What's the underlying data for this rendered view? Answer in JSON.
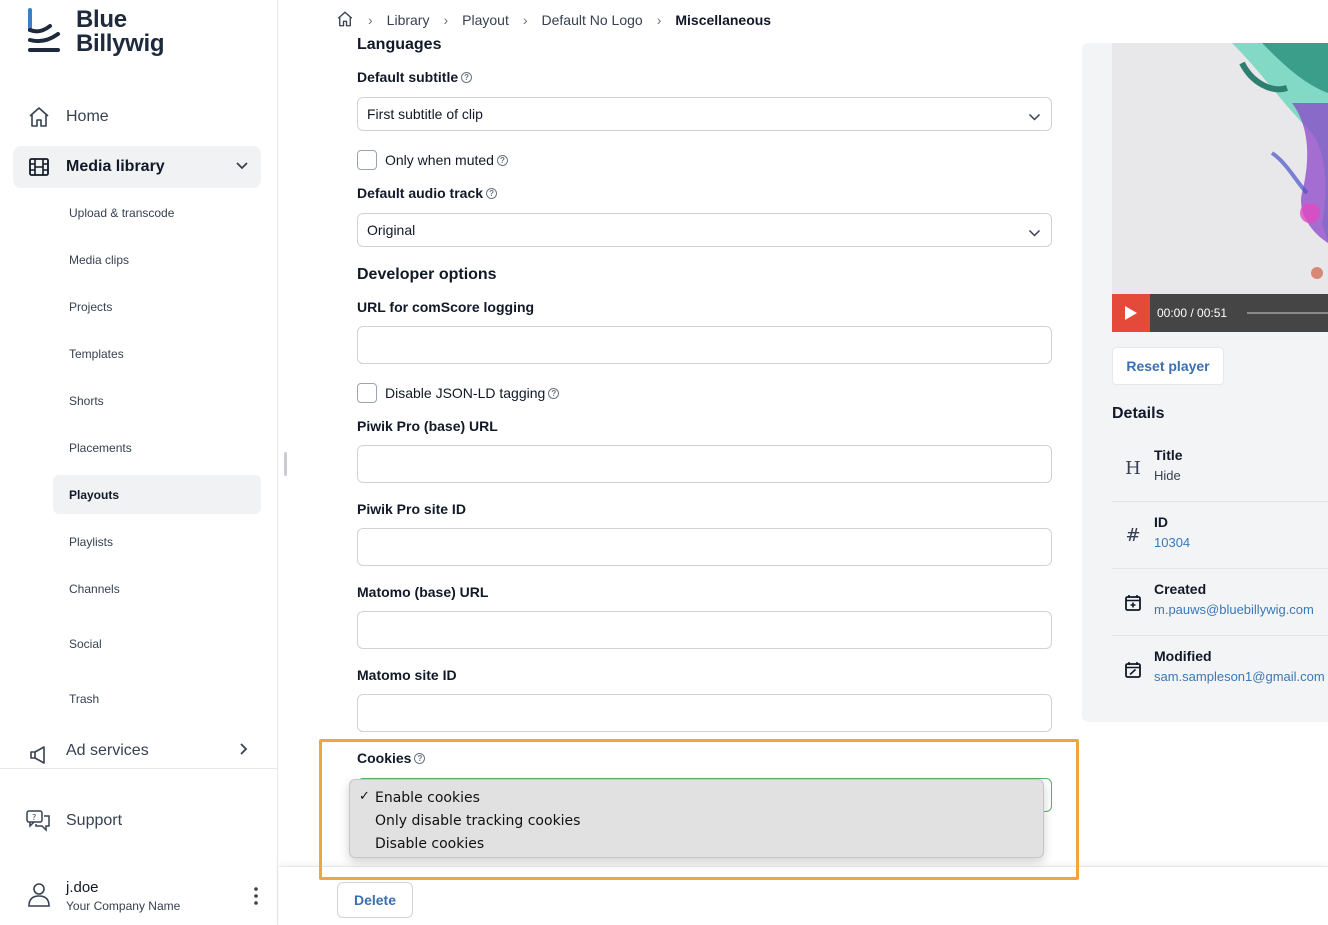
{
  "app": {
    "logo_line1": "Blue",
    "logo_line2": "Billywig"
  },
  "sidebar": {
    "home": "Home",
    "media_library": "Media library",
    "sub_items": [
      "Upload & transcode",
      "Media clips",
      "Projects",
      "Templates",
      "Shorts",
      "Placements",
      "Playouts",
      "Playlists",
      "Channels",
      "Social",
      "Trash"
    ],
    "active_sub": "Playouts",
    "ad_services": "Ad services",
    "support": "Support",
    "user_name": "j.doe",
    "company": "Your Company Name"
  },
  "breadcrumb": {
    "items": [
      "Library",
      "Playout",
      "Default No Logo"
    ],
    "current": "Miscellaneous"
  },
  "form": {
    "languages_title": "Languages",
    "default_subtitle_label": "Default subtitle",
    "default_subtitle_value": "First subtitle of clip",
    "only_when_muted_label": "Only when muted",
    "default_audio_label": "Default audio track",
    "default_audio_value": "Original",
    "developer_title": "Developer options",
    "comscore_label": "URL for comScore logging",
    "disable_jsonld_label": "Disable JSON-LD tagging",
    "piwik_url_label": "Piwik Pro (base) URL",
    "piwik_site_label": "Piwik Pro site ID",
    "matomo_url_label": "Matomo (base) URL",
    "matomo_site_label": "Matomo site ID",
    "cookies_label": "Cookies",
    "cookie_options": [
      "Enable cookies",
      "Only disable tracking cookies",
      "Disable cookies"
    ],
    "cookie_selected": "Enable cookies",
    "tick": "✓"
  },
  "actions": {
    "delete": "Delete"
  },
  "right_panel": {
    "time": "00:00 / 00:51",
    "reset_player": "Reset player",
    "details_title": "Details",
    "details": [
      {
        "label": "Title",
        "value": "Hide",
        "icon": "title-icon",
        "glyph": "H"
      },
      {
        "label": "ID",
        "value": "10304",
        "icon": "hash-icon",
        "glyph": "#"
      },
      {
        "label": "Created",
        "value": "m.pauws@bluebillywig.com",
        "icon": "calendar-add-icon",
        "glyph": ""
      },
      {
        "label": "Modified",
        "value": "sam.sampleson1@gmail.com",
        "icon": "calendar-edit-icon",
        "glyph": ""
      }
    ]
  },
  "colors": {
    "accent_link": "#3a78b8",
    "play_button": "#e5493a",
    "highlight": "#f2a53a",
    "focus_border": "#57b26a"
  }
}
